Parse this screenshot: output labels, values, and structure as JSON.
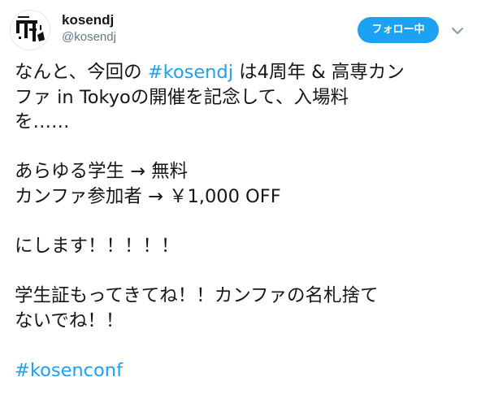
{
  "colors": {
    "accent": "#1da1f2",
    "follow_button_bg": "#1da1f2",
    "hashtag": "#1da1f2",
    "text_primary": "#14171a",
    "text_secondary": "#657786"
  },
  "header": {
    "avatar_icon": "kosendj-logo-icon",
    "display_name": "kosendj",
    "screen_name": "@kosendj",
    "follow_label": "フォロー中",
    "menu_icon": "chevron-down-icon"
  },
  "tweet": {
    "line1_pre": "なんと、今回の ",
    "line1_tag": "#kosendj",
    "line1_post": " は4周年 & 高専カン",
    "line2": "ファ in Tokyoの開催を記念して、入場料",
    "line3": "を……",
    "line5": "あらゆる学生 → 無料",
    "line6": "カンファ参加者 → ￥1,000 OFF",
    "line8": "にします！！！！！",
    "line10": "学生証もってきてね！！カンファの名札捨て",
    "line11": "ないでね！！",
    "line13_tag": "#kosenconf"
  }
}
